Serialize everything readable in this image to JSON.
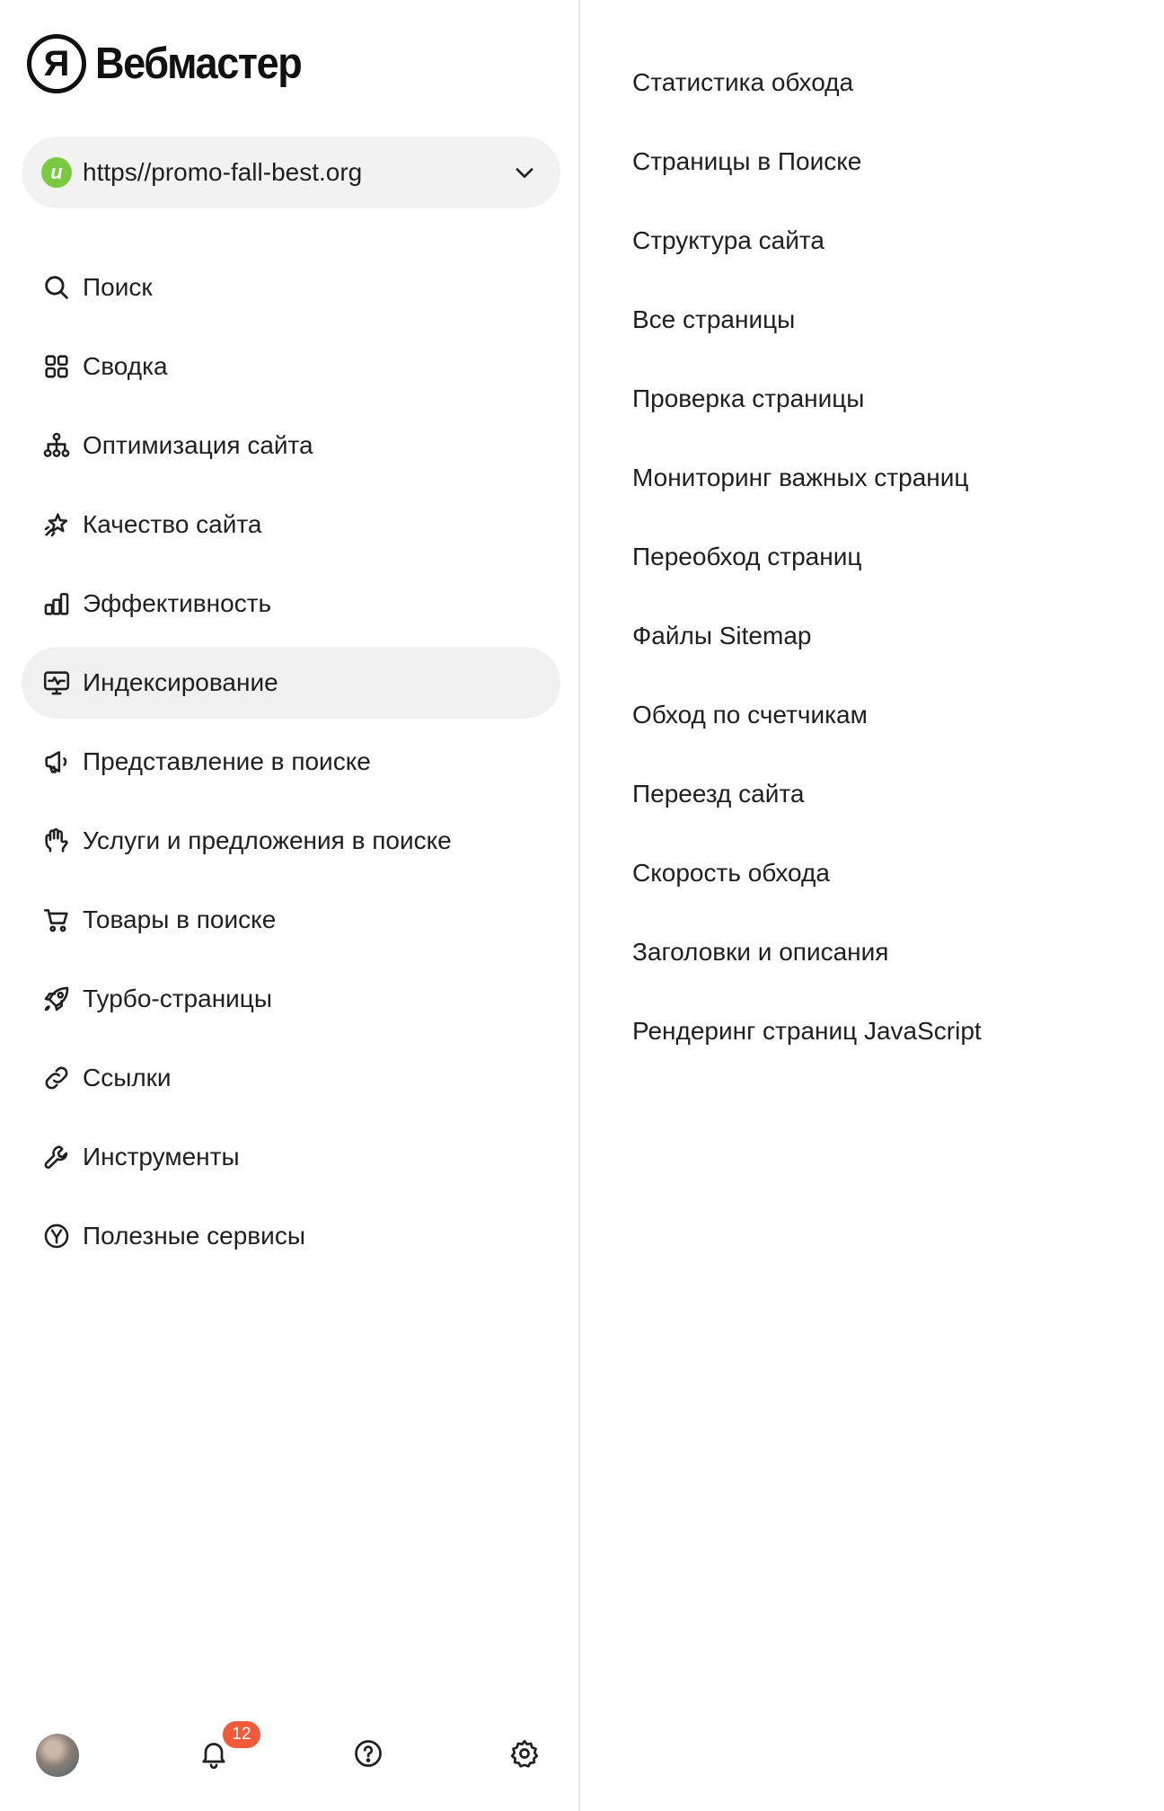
{
  "app": {
    "name": "Вебмастер",
    "logo_letter": "Я"
  },
  "site_selector": {
    "url": "https//promo-fall-best.org",
    "favicon_letter": "u",
    "favicon_color": "#7ac943"
  },
  "nav": [
    {
      "label": "Поиск",
      "icon": "search-icon"
    },
    {
      "label": "Сводка",
      "icon": "grid-icon"
    },
    {
      "label": "Оптимизация сайта",
      "icon": "sitemap-icon"
    },
    {
      "label": "Качество сайта",
      "icon": "sparkle-star-icon"
    },
    {
      "label": "Эффективность",
      "icon": "bar-chart-icon"
    },
    {
      "label": "Индексирование",
      "icon": "monitor-pulse-icon",
      "active": true
    },
    {
      "label": "Представление в поиске",
      "icon": "megaphone-icon"
    },
    {
      "label": "Услуги и предложения в поиске",
      "icon": "hand-icon"
    },
    {
      "label": "Товары в поиске",
      "icon": "cart-icon"
    },
    {
      "label": "Турбо-страницы",
      "icon": "rocket-icon"
    },
    {
      "label": "Ссылки",
      "icon": "link-icon"
    },
    {
      "label": "Инструменты",
      "icon": "wrench-icon"
    },
    {
      "label": "Полезные сервисы",
      "icon": "yandex-circle-icon"
    }
  ],
  "submenu": [
    "Статистика обхода",
    "Страницы в Поиске",
    "Структура сайта",
    "Все страницы",
    "Проверка страницы",
    "Мониторинг важных страниц",
    "Переобход страниц",
    "Файлы Sitemap",
    "Обход по счетчикам",
    "Переезд сайта",
    "Скорость обхода",
    "Заголовки и описания",
    "Рендеринг страниц JavaScript"
  ],
  "bottom": {
    "notifications_count": "12"
  },
  "colors": {
    "accent_badge": "#f05a3a",
    "active_bg": "#f0f0f0",
    "select_bg": "#f2f2f2"
  }
}
